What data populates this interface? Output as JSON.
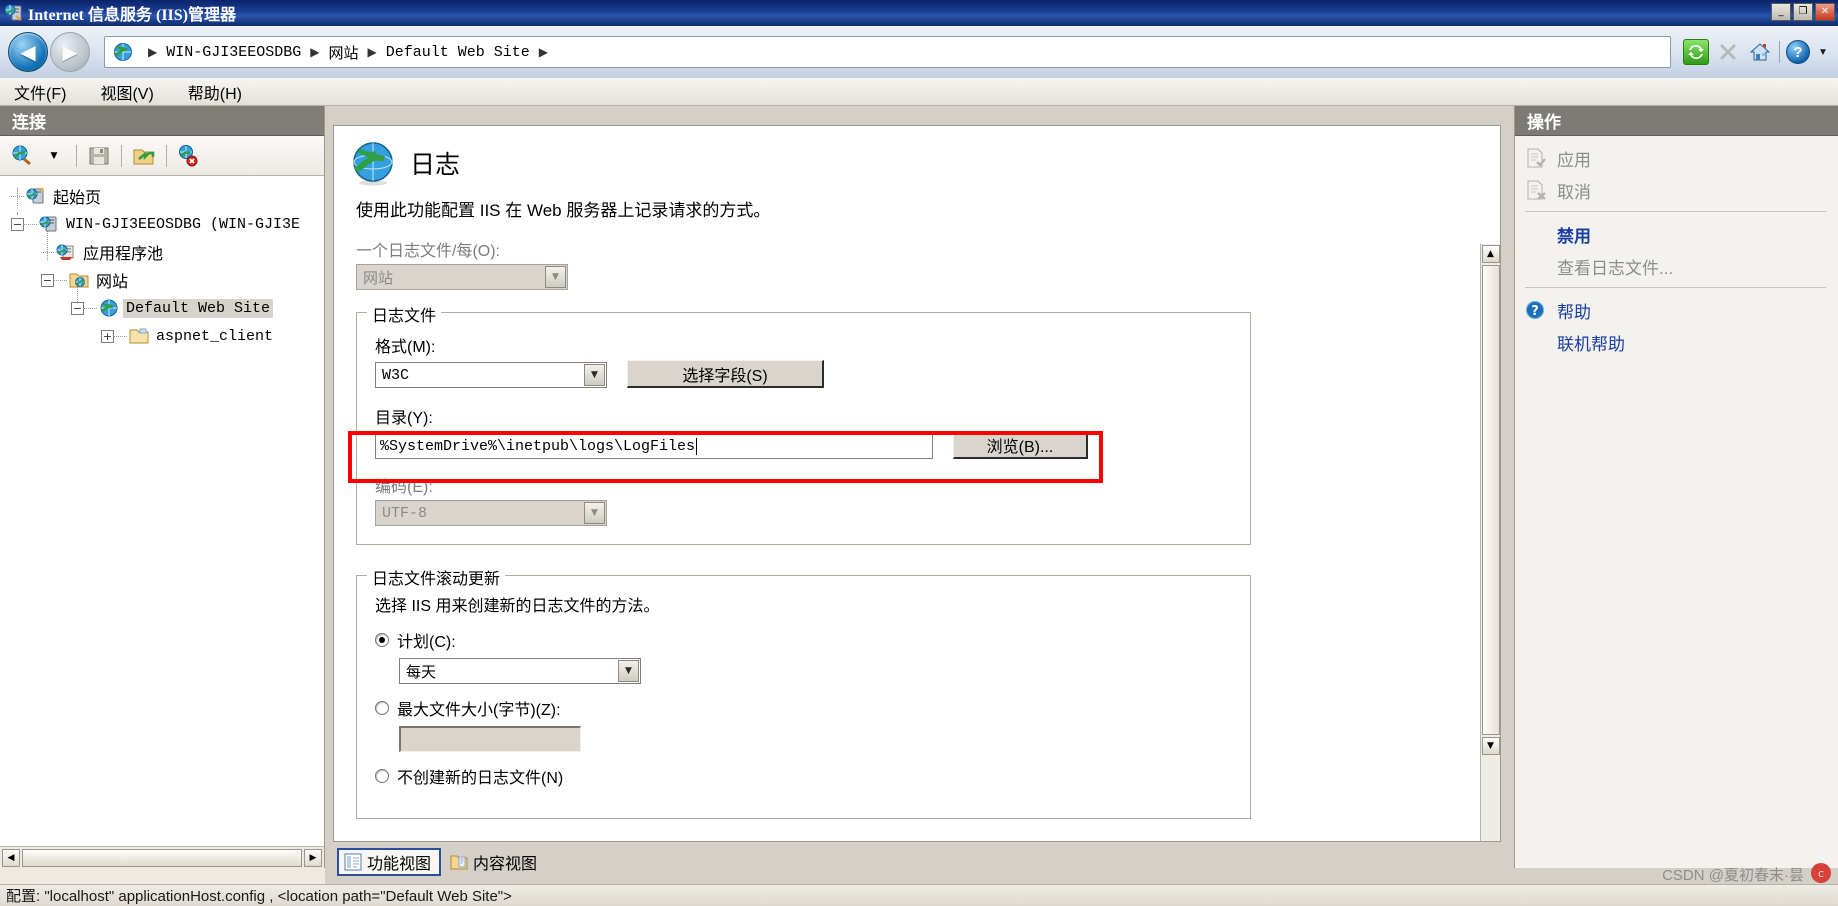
{
  "window": {
    "title": "Internet 信息服务 (IIS)管理器",
    "minimize": "_",
    "maximize": "❐",
    "close": "✕",
    "titlebar_icon": "iis-manager-icon"
  },
  "nav": {
    "back_icon": "back-arrow-icon",
    "forward_icon": "forward-arrow-icon",
    "back_glyph": "◀",
    "forward_glyph": "▶",
    "address_icon": "globe-icon",
    "breadcrumb": [
      {
        "label": "WIN-GJI3EEOSDBG",
        "mono": true
      },
      {
        "label": "网站",
        "mono": false
      },
      {
        "label": "Default Web Site",
        "mono": true
      }
    ],
    "separator": "▶",
    "tools": [
      {
        "name": "refresh-icon",
        "glyph": "⟳",
        "kind": "refresh"
      },
      {
        "name": "stop-icon",
        "glyph": "✕",
        "kind": "stop"
      },
      {
        "name": "home-icon",
        "glyph": "⌂",
        "kind": "home"
      },
      {
        "name": "help-icon",
        "glyph": "?",
        "kind": "help"
      },
      {
        "name": "chevron-down-icon",
        "glyph": "▼",
        "kind": "caret"
      }
    ]
  },
  "menu": [
    {
      "label": "文件(F)"
    },
    {
      "label": "视图(V)"
    },
    {
      "label": "帮助(H)"
    }
  ],
  "connections": {
    "header": "连接",
    "toolbar": [
      {
        "name": "connect-to-icon",
        "glyph": ""
      },
      {
        "name": "chevron-down-icon",
        "glyph": "▼"
      },
      {
        "name": "save-icon",
        "glyph": ""
      },
      {
        "name": "connect-site-icon",
        "glyph": ""
      },
      {
        "name": "disconnect-icon",
        "glyph": ""
      }
    ],
    "tree": [
      {
        "label": "起始页",
        "icon": "start-page-icon",
        "indent": 1,
        "expander": "none",
        "mono": false,
        "selected": false
      },
      {
        "label": "WIN-GJI3EEOSDBG (WIN-GJI3E",
        "icon": "server-icon",
        "indent": 1,
        "expander": "minus",
        "mono": true,
        "selected": false
      },
      {
        "label": "应用程序池",
        "icon": "app-pools-icon",
        "indent": 2,
        "expander": "none",
        "mono": false,
        "selected": false
      },
      {
        "label": "网站",
        "icon": "sites-folder-icon",
        "indent": 2,
        "expander": "minus",
        "mono": false,
        "selected": false
      },
      {
        "label": "Default Web Site",
        "icon": "website-icon",
        "indent": 3,
        "expander": "minus",
        "mono": true,
        "selected": true
      },
      {
        "label": "aspnet_client",
        "icon": "folder-icon",
        "indent": 4,
        "expander": "plus",
        "mono": true,
        "selected": false
      }
    ],
    "hscroll": {
      "left_glyph": "◀",
      "right_glyph": "▶"
    }
  },
  "main": {
    "icon": "logging-globe-icon",
    "title": "日志",
    "description": "使用此功能配置 IIS 在 Web 服务器上记录请求的方式。",
    "per_log_file": {
      "label": "一个日志文件/每(O):",
      "value": "网站",
      "disabled": true,
      "arrow": "▼"
    },
    "log_file_group": {
      "legend": "日志文件",
      "format_label": "格式(M):",
      "format_value": "W3C",
      "format_arrow": "▼",
      "select_fields_button": "选择字段(S)",
      "directory_label": "目录(Y):",
      "directory_value": "%SystemDrive%\\inetpub\\logs\\LogFiles",
      "browse_button": "浏览(B)...",
      "encoding_label": "编码(E):",
      "encoding_value": "UTF-8",
      "encoding_arrow": "▼",
      "highlight_color": "#ff0000"
    },
    "rollover_group": {
      "legend": "日志文件滚动更新",
      "description": "选择 IIS 用来创建新的日志文件的方法。",
      "schedule_label": "计划(C):",
      "schedule_selected": true,
      "schedule_value": "每天",
      "schedule_arrow": "▼",
      "maxsize_label": "最大文件大小(字节)(Z):",
      "maxsize_selected": false,
      "maxsize_value": "",
      "nonew_label": "不创建新的日志文件(N)",
      "nonew_selected": false
    },
    "scrollbar": {
      "up_glyph": "▲",
      "down_glyph": "▼"
    }
  },
  "actions": {
    "header": "操作",
    "items": [
      {
        "label": "应用",
        "icon": "apply-icon",
        "state": "disabled",
        "has_icon": true
      },
      {
        "label": "取消",
        "icon": "cancel-icon",
        "state": "disabled",
        "has_icon": true
      },
      {
        "separator": true
      },
      {
        "label": "禁用",
        "icon": "",
        "state": "bold-link",
        "has_icon": false
      },
      {
        "label": "查看日志文件...",
        "icon": "",
        "state": "disabled",
        "has_icon": false
      },
      {
        "separator": true
      },
      {
        "label": "帮助",
        "icon": "help-icon",
        "state": "link",
        "has_icon": true
      },
      {
        "label": "联机帮助",
        "icon": "",
        "state": "link",
        "has_icon": false
      }
    ]
  },
  "view_tabs": [
    {
      "label": "功能视图",
      "icon": "features-view-icon",
      "active": true
    },
    {
      "label": "内容视图",
      "icon": "content-view-icon",
      "active": false
    }
  ],
  "status": {
    "text_prefix": "配置:",
    "text": "配置: \"localhost\" applicationHost.config , <location path=\"Default Web Site\">",
    "watermark": "CSDN @夏初春末·昙",
    "watermark_icon": "csdn-logo-icon"
  },
  "colors": {
    "title_bar": "#0a246a",
    "accent_link": "#1b3fa0",
    "highlight_red": "#ff0000",
    "panel_bg": "#f3f2ef",
    "dialog_bg": "#d4d0c8"
  }
}
